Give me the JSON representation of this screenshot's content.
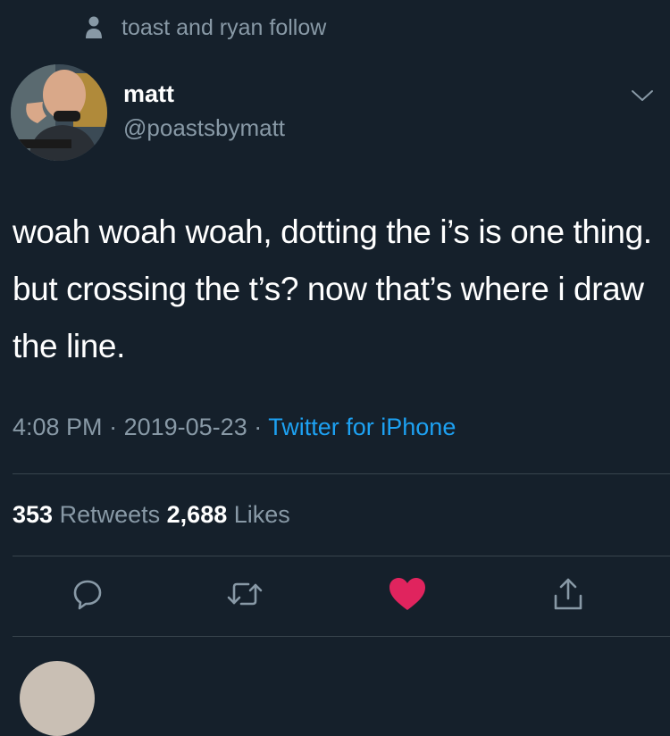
{
  "social_context": {
    "text": "toast and ryan follow",
    "icon": "person-icon"
  },
  "author": {
    "display_name": "matt",
    "handle": "@poastsbymatt",
    "avatar": "avatar-photo"
  },
  "tweet": {
    "text": "woah woah woah, dotting the i’s is one thing. but crossing the t’s? now that’s where i draw the line."
  },
  "meta": {
    "time": "4:08 PM",
    "date": "2019-05-23",
    "separator": "·",
    "source": "Twitter for iPhone"
  },
  "stats": {
    "retweets_count": "353",
    "retweets_label": "Retweets",
    "likes_count": "2,688",
    "likes_label": "Likes"
  },
  "actions": [
    {
      "name": "reply",
      "icon": "reply-icon"
    },
    {
      "name": "retweet",
      "icon": "retweet-icon"
    },
    {
      "name": "like",
      "icon": "heart-icon",
      "active": true
    },
    {
      "name": "share",
      "icon": "share-icon"
    }
  ],
  "colors": {
    "background": "#15202b",
    "text_primary": "#ffffff",
    "text_secondary": "#8899a6",
    "link": "#1da1f2",
    "like_active": "#e0245e",
    "divider": "#38444d"
  }
}
